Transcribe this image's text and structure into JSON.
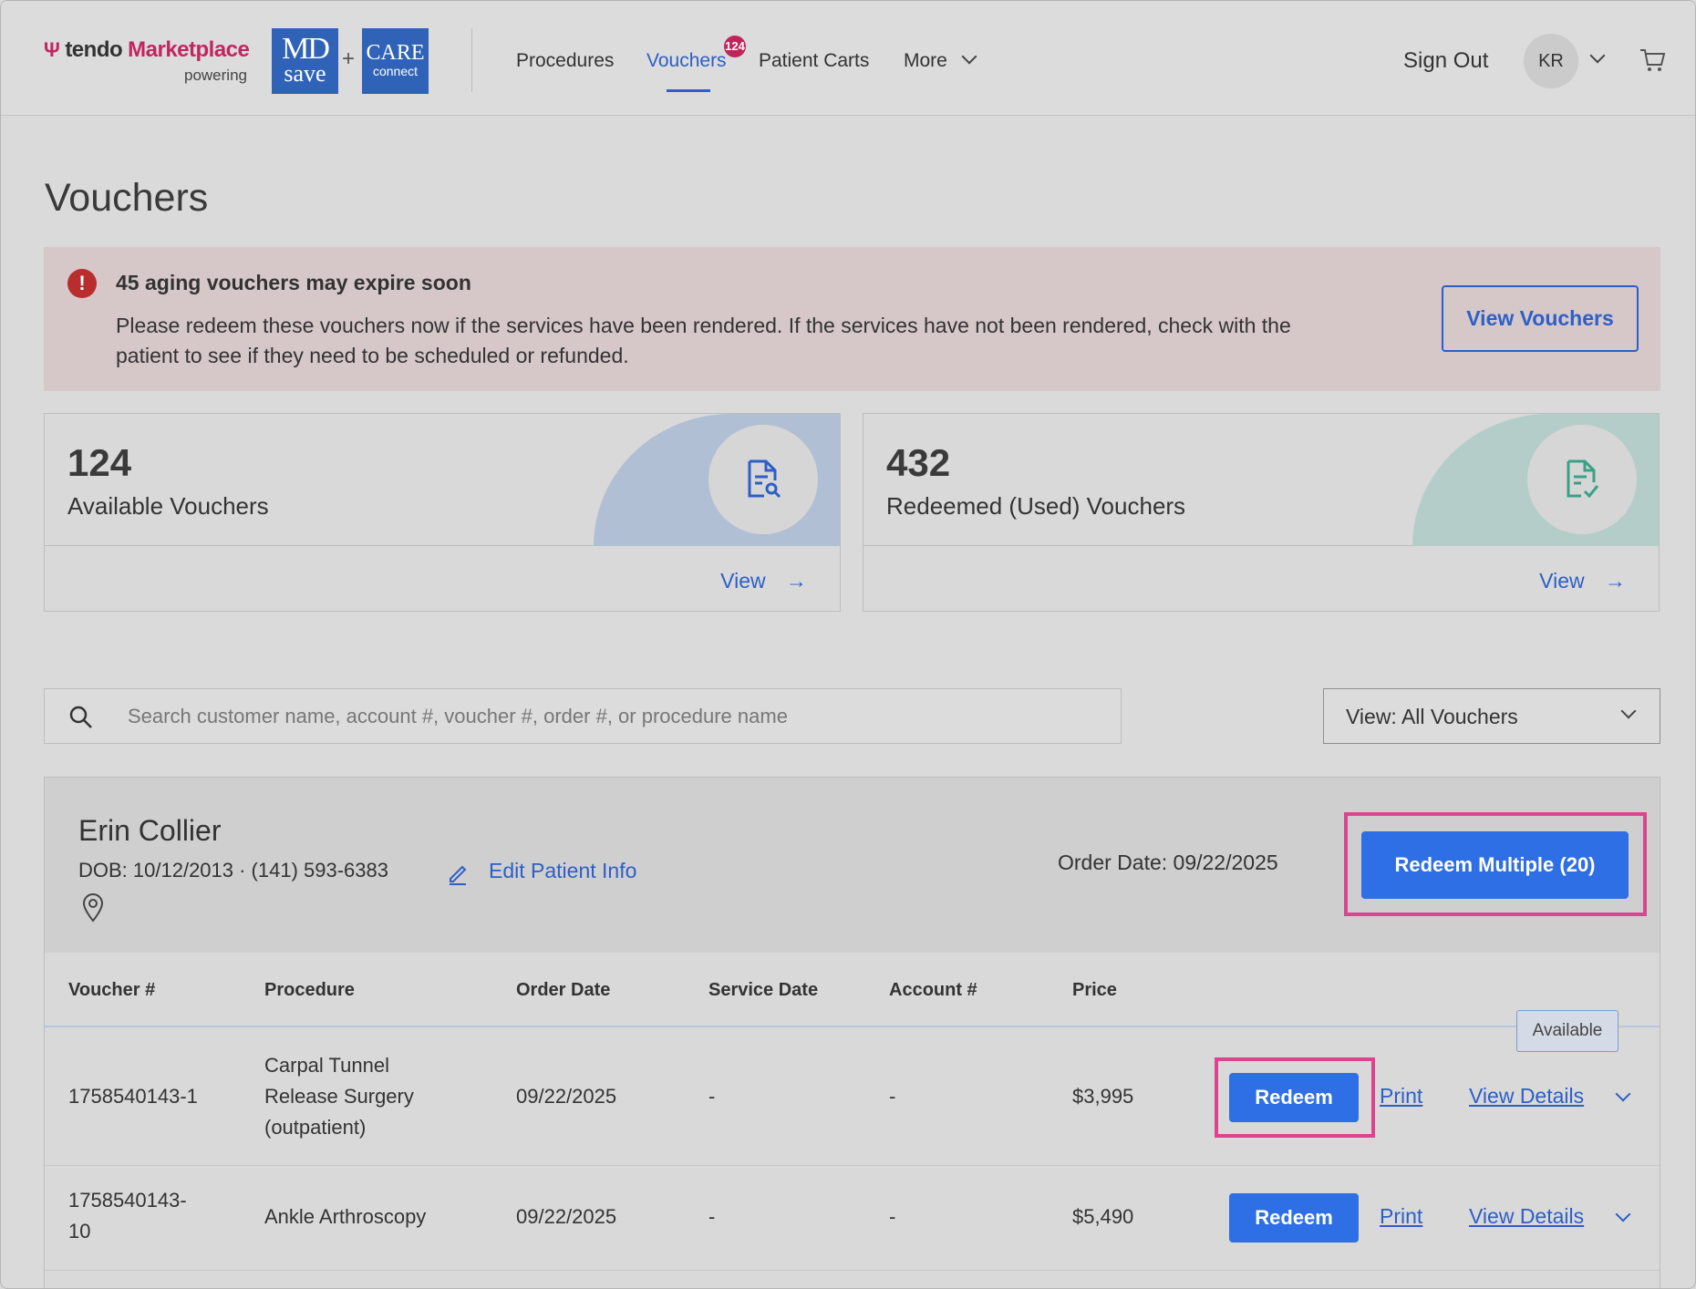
{
  "header": {
    "brand_tendo": "tendo",
    "brand_marketplace": "Marketplace",
    "brand_powering": "powering",
    "logo_md_top": "MD",
    "logo_md_bottom": "save",
    "logo_plus": "+",
    "logo_care_top": "CARE",
    "logo_care_bottom": "connect",
    "nav": [
      {
        "label": "Procedures"
      },
      {
        "label": "Vouchers",
        "badge": "124",
        "active": true
      },
      {
        "label": "Patient Carts"
      },
      {
        "label": "More"
      }
    ],
    "sign_out": "Sign Out",
    "avatar_initials": "KR",
    "accent_color": "#2d5fc7",
    "brand_color": "#c2265f"
  },
  "page": {
    "title": "Vouchers"
  },
  "alert": {
    "title": "45 aging vouchers may expire soon",
    "body": "Please redeem these vouchers now if the services have been rendered. If the services have not been rendered, check with the patient to see if they need to be scheduled or refunded.",
    "button": "View Vouchers",
    "icon": "exclamation-icon"
  },
  "stats": [
    {
      "value": "124",
      "label": "Available Vouchers",
      "link": "View",
      "icon": "document-search-icon"
    },
    {
      "value": "432",
      "label": "Redeemed (Used) Vouchers",
      "link": "View",
      "icon": "document-check-icon"
    }
  ],
  "search": {
    "placeholder": "Search customer name, account #, voucher #, order #, or procedure name"
  },
  "filter": {
    "selected": "View: All Vouchers"
  },
  "patient": {
    "name": "Erin Collier",
    "dob_phone": "DOB: 10/12/2013 · (141) 593-6383",
    "edit_label": "Edit Patient Info",
    "order_date": "Order Date: 09/22/2025",
    "redeem_multiple": "Redeem Multiple (20)"
  },
  "table": {
    "columns": [
      "Voucher #",
      "Procedure",
      "Order Date",
      "Service Date",
      "Account #",
      "Price"
    ],
    "rows": [
      {
        "voucher": "1758540143-1",
        "procedure_lines": [
          "Carpal Tunnel",
          "Release Surgery",
          "(outpatient)"
        ],
        "order_date": "09/22/2025",
        "service_date": "-",
        "account": "-",
        "price": "$3,995",
        "status": "Available",
        "redeem": "Redeem",
        "print": "Print",
        "details": "View Details"
      },
      {
        "voucher_lines": [
          "1758540143-",
          "10"
        ],
        "procedure": "Ankle Arthroscopy",
        "order_date": "09/22/2025",
        "service_date": "-",
        "account": "-",
        "price": "$5,490",
        "redeem": "Redeem",
        "print": "Print",
        "details": "View Details"
      }
    ]
  }
}
